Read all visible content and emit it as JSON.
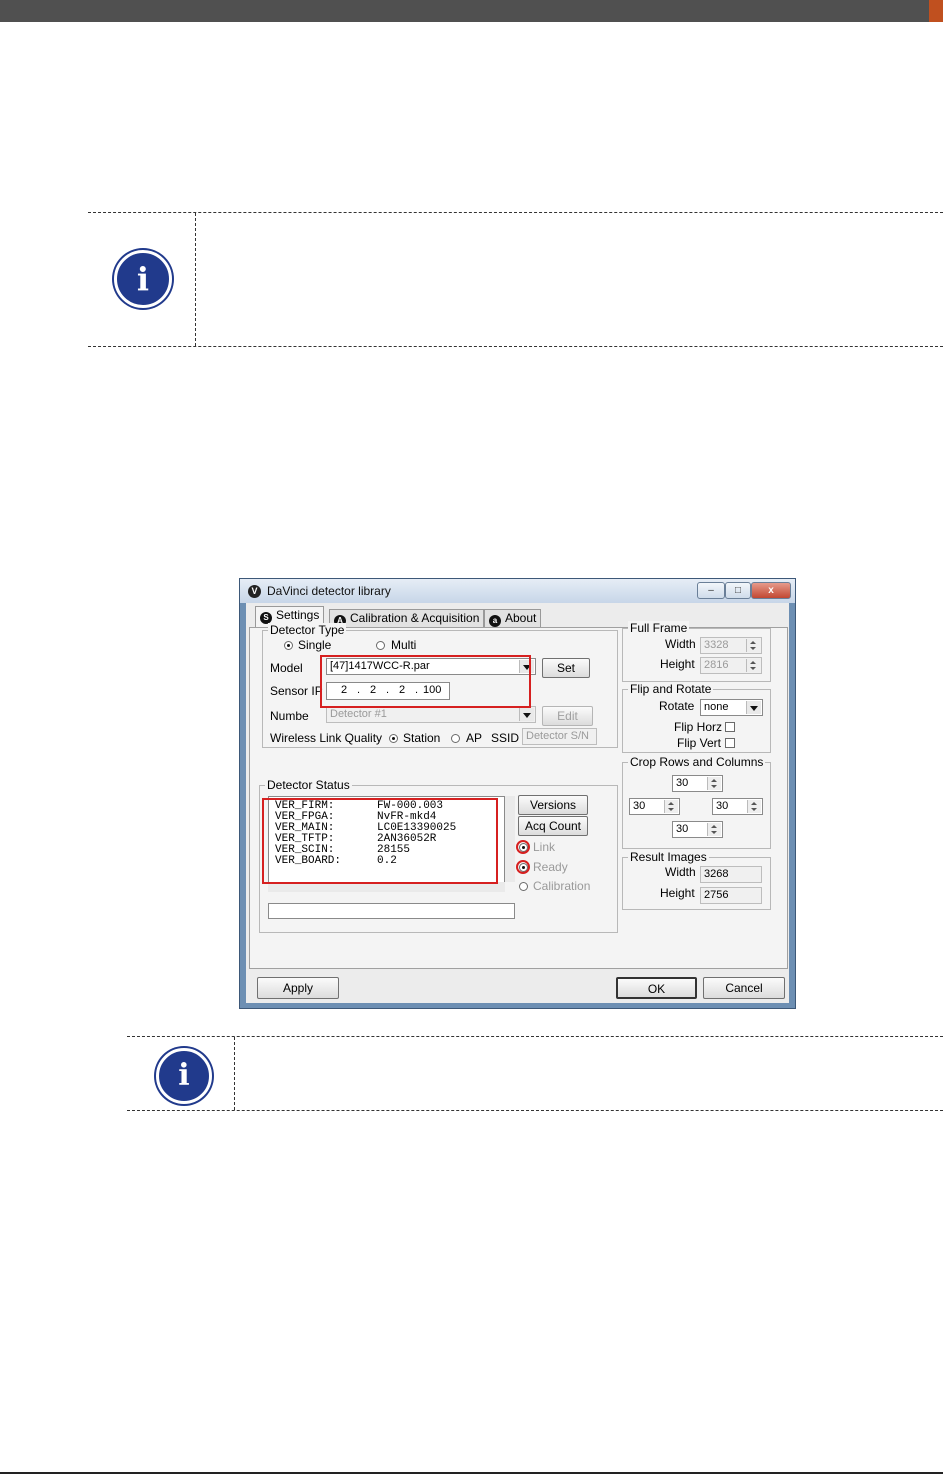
{
  "window": {
    "title": "DaVinci detector library",
    "logo_letter": "V",
    "min_label": "–",
    "max_label": "□",
    "close_label": "x"
  },
  "tabs": [
    {
      "icon_letter": "S",
      "label": "Settings"
    },
    {
      "icon_letter": "A",
      "label": "Calibration & Acquisition"
    },
    {
      "icon_letter": "a",
      "label": "About"
    }
  ],
  "detector_type": {
    "title": "Detector Type",
    "single": "Single",
    "multi": "Multi",
    "model_label": "Model",
    "model_value": "[47]1417WCC-R.par",
    "set_button": "Set",
    "sensor_ip_label": "Sensor IP",
    "ip_parts": [
      "2",
      "2",
      "2",
      "100"
    ],
    "ip_dot": ".",
    "number_label": "Numbe",
    "number_value": "Detector #1",
    "edit_button": "Edit",
    "wireless_label": "Wireless Link Quality",
    "station": "Station",
    "ap": "AP",
    "ssid_label": "SSID",
    "ssid_value": "Detector S/N"
  },
  "detector_status": {
    "title": "Detector Status",
    "rows": [
      {
        "key": "VER_FIRM:",
        "value": "FW-000.003"
      },
      {
        "key": "VER_FPGA:",
        "value": "NvFR-mkd4"
      },
      {
        "key": "VER_MAIN:",
        "value": "LC0E13390025"
      },
      {
        "key": "VER_TFTP:",
        "value": "2AN36052R"
      },
      {
        "key": "VER_SCIN:",
        "value": "28155"
      },
      {
        "key": "VER_BOARD:",
        "value": "0.2"
      }
    ],
    "versions_button": "Versions",
    "acq_count_button": "Acq Count",
    "link": "Link",
    "ready": "Ready",
    "calibration": "Calibration"
  },
  "full_frame": {
    "title": "Full Frame",
    "width_label": "Width",
    "width_value": "3328",
    "height_label": "Height",
    "height_value": "2816"
  },
  "flip_rotate": {
    "title": "Flip and Rotate",
    "rotate_label": "Rotate",
    "rotate_value": "none",
    "flip_horz": "Flip Horz",
    "flip_vert": "Flip Vert"
  },
  "crop": {
    "title": "Crop Rows and Columns",
    "top": "30",
    "left": "30",
    "right": "30",
    "bottom": "30"
  },
  "result_images": {
    "title": "Result Images",
    "width_label": "Width",
    "width_value": "3268",
    "height_label": "Height",
    "height_value": "2756"
  },
  "footer": {
    "apply": "Apply",
    "ok": "OK",
    "cancel": "Cancel"
  },
  "note_icon_letter": "i",
  "colors": {
    "header_bar": "#505050",
    "header_accent": "#c0501f",
    "info_icon": "#213a8c",
    "highlight": "#d62020"
  }
}
